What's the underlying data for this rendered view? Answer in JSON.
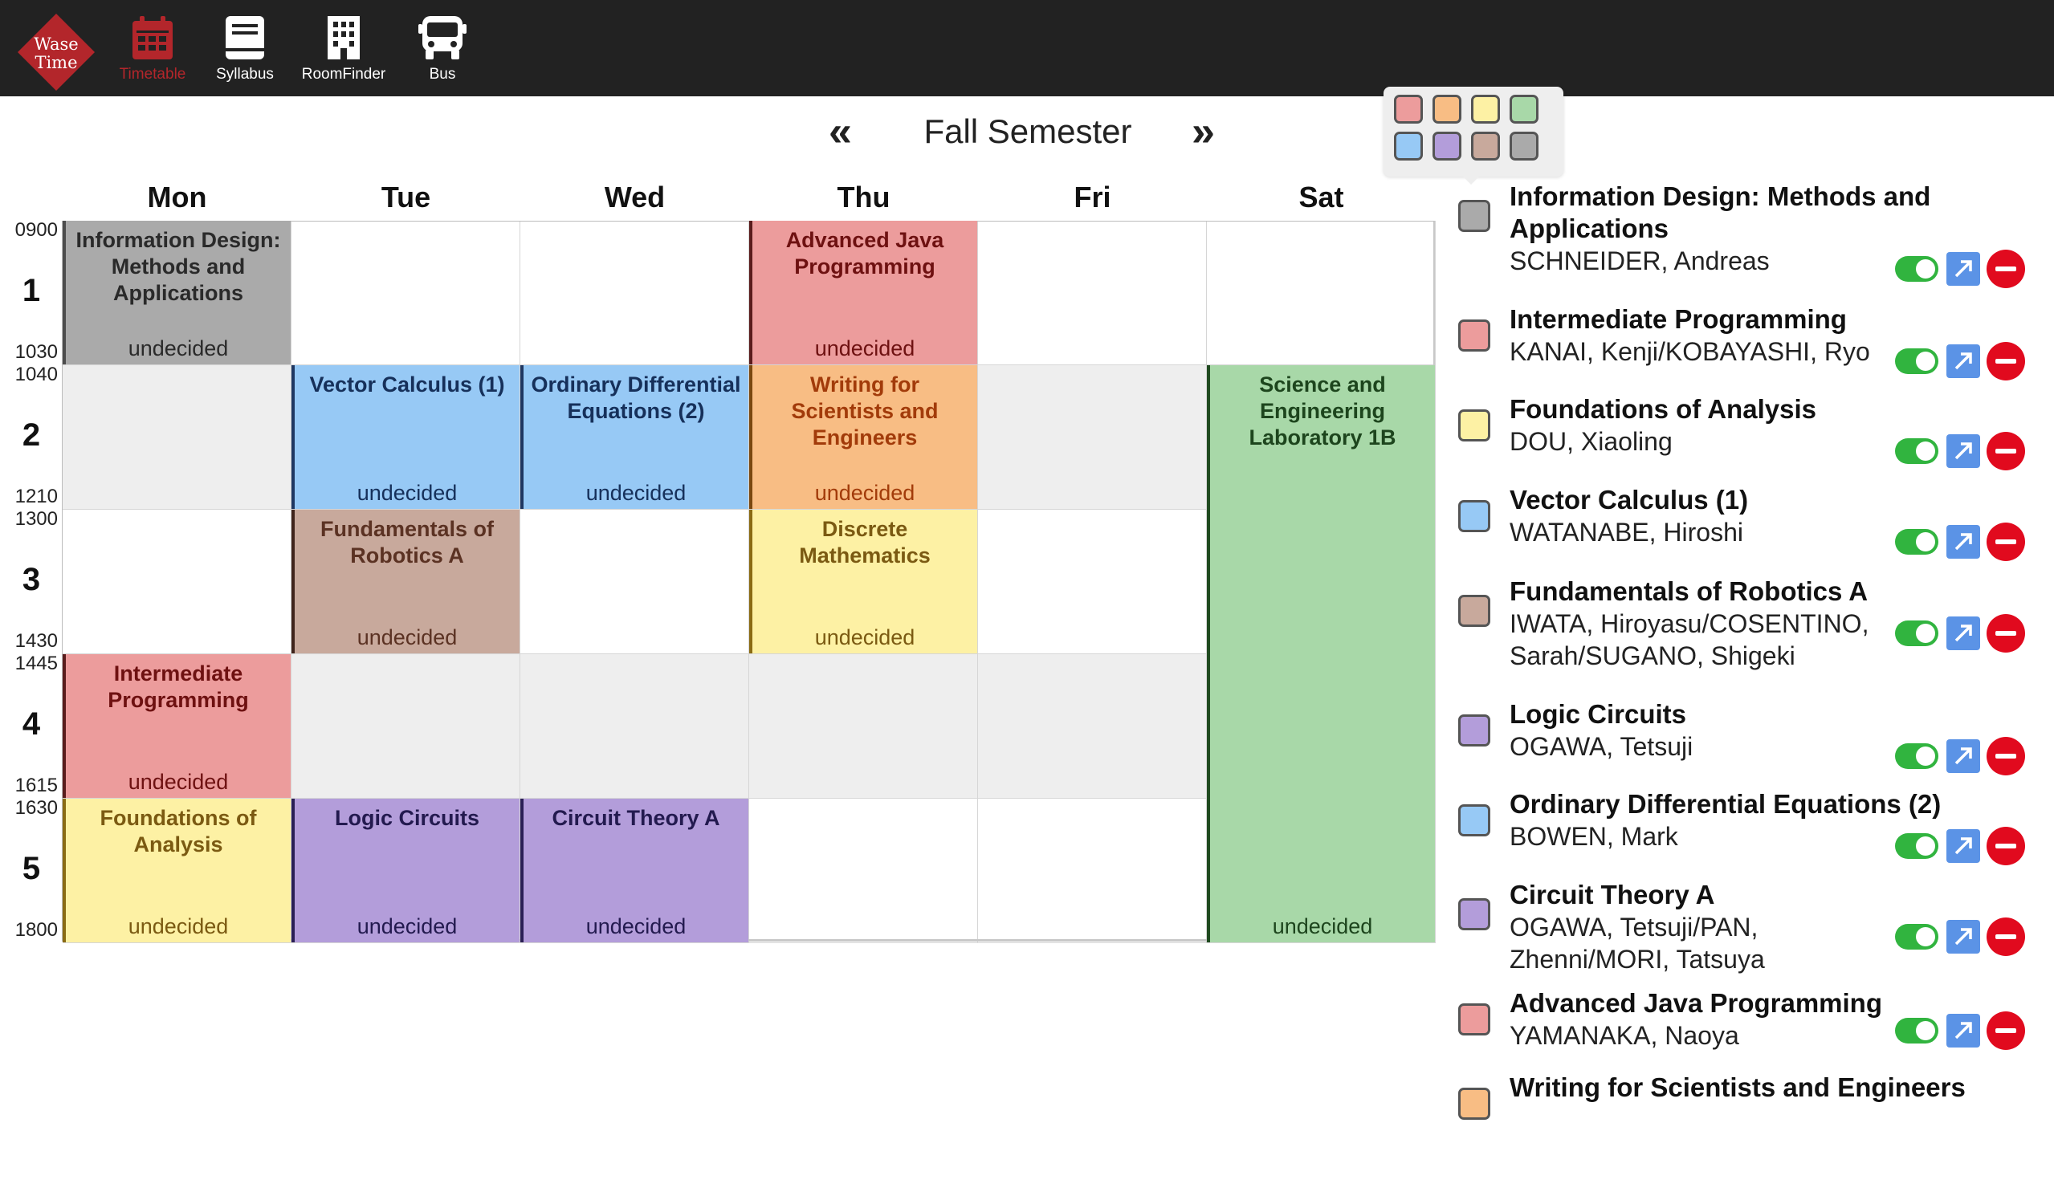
{
  "logo": {
    "line1": "Wase",
    "line2": "Time"
  },
  "nav": [
    {
      "label": "Timetable",
      "icon": "calendar-icon",
      "active": true
    },
    {
      "label": "Syllabus",
      "icon": "book-icon",
      "active": false
    },
    {
      "label": "RoomFinder",
      "icon": "building-icon",
      "active": false
    },
    {
      "label": "Bus",
      "icon": "bus-icon",
      "active": false
    }
  ],
  "semester": {
    "title": "Fall Semester",
    "prev": "«",
    "next": "»"
  },
  "days": [
    "Mon",
    "Tue",
    "Wed",
    "Thu",
    "Fri",
    "Sat"
  ],
  "periods": [
    {
      "num": "1",
      "start": "0900",
      "end": "1030"
    },
    {
      "num": "2",
      "start": "1040",
      "end": "1210"
    },
    {
      "num": "3",
      "start": "1300",
      "end": "1430"
    },
    {
      "num": "4",
      "start": "1445",
      "end": "1615"
    },
    {
      "num": "5",
      "start": "1630",
      "end": "1800"
    }
  ],
  "colors": {
    "gray": "#aaaaaa",
    "red": "#ec9c9c",
    "orange": "#f8bd84",
    "yellow": "#fdf1a4",
    "blue": "#97c9f5",
    "purple": "#b39dda",
    "brown": "#c8a99c",
    "green": "#a8d8a8"
  },
  "timetable": [
    {
      "title": "Information Design: Methods and Applications",
      "room": "undecided",
      "day": "Mon",
      "period": 1,
      "span": 1,
      "color": "gray"
    },
    {
      "title": "Advanced Java Programming",
      "room": "undecided",
      "day": "Thu",
      "period": 1,
      "span": 1,
      "color": "red"
    },
    {
      "title": "Vector Calculus (1)",
      "room": "undecided",
      "day": "Tue",
      "period": 2,
      "span": 1,
      "color": "blue"
    },
    {
      "title": "Ordinary Differential Equations (2)",
      "room": "undecided",
      "day": "Wed",
      "period": 2,
      "span": 1,
      "color": "blue"
    },
    {
      "title": "Writing for Scientists and Engineers",
      "room": "undecided",
      "day": "Thu",
      "period": 2,
      "span": 1,
      "color": "orange"
    },
    {
      "title": "Science and Engineering Laboratory 1B",
      "room": "undecided",
      "day": "Sat",
      "period": 2,
      "span": 4,
      "color": "green"
    },
    {
      "title": "Fundamentals of Robotics A",
      "room": "undecided",
      "day": "Tue",
      "period": 3,
      "span": 1,
      "color": "brown"
    },
    {
      "title": "Discrete Mathematics",
      "room": "undecided",
      "day": "Thu",
      "period": 3,
      "span": 1,
      "color": "yellow"
    },
    {
      "title": "Intermediate Programming",
      "room": "undecided",
      "day": "Mon",
      "period": 4,
      "span": 1,
      "color": "red"
    },
    {
      "title": "Foundations of Analysis",
      "room": "undecided",
      "day": "Mon",
      "period": 5,
      "span": 1,
      "color": "yellow"
    },
    {
      "title": "Logic Circuits",
      "room": "undecided",
      "day": "Tue",
      "period": 5,
      "span": 1,
      "color": "purple"
    },
    {
      "title": "Circuit Theory A",
      "room": "undecided",
      "day": "Wed",
      "period": 5,
      "span": 1,
      "color": "purple"
    }
  ],
  "palette": [
    "red",
    "orange",
    "yellow",
    "green",
    "blue",
    "purple",
    "brown",
    "gray"
  ],
  "course_list": [
    {
      "title": "Information Design: Methods and Applications",
      "instructor": "SCHNEIDER, Andreas",
      "color": "gray"
    },
    {
      "title": "Intermediate Programming",
      "instructor": "KANAI, Kenji/KOBAYASHI, Ryo",
      "color": "red"
    },
    {
      "title": "Foundations of Analysis",
      "instructor": "DOU, Xiaoling",
      "color": "yellow"
    },
    {
      "title": "Vector Calculus (1)",
      "instructor": "WATANABE, Hiroshi",
      "color": "blue"
    },
    {
      "title": "Fundamentals of Robotics A",
      "instructor": "IWATA, Hiroyasu/COSENTINO, Sarah/SUGANO, Shigeki",
      "color": "brown"
    },
    {
      "title": "Logic Circuits",
      "instructor": "OGAWA, Tetsuji",
      "color": "purple"
    },
    {
      "title": "Ordinary Differential Equations (2)",
      "instructor": "BOWEN, Mark",
      "color": "blue"
    },
    {
      "title": "Circuit Theory A",
      "instructor": "OGAWA, Tetsuji/PAN, Zhenni/MORI, Tatsuya",
      "color": "purple"
    },
    {
      "title": "Advanced Java Programming",
      "instructor": "YAMANAKA, Naoya",
      "color": "red"
    },
    {
      "title": "Writing for Scientists and Engineers",
      "instructor": "",
      "color": "orange"
    }
  ]
}
